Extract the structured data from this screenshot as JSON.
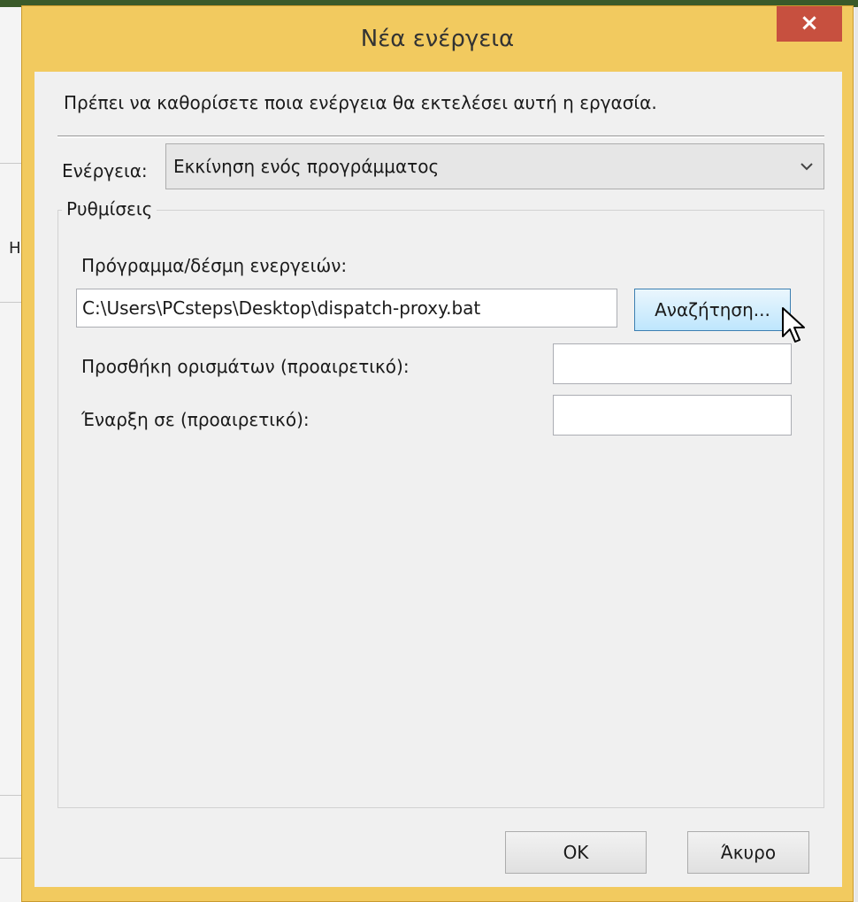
{
  "dialog": {
    "title": "Νέα ενέργεια",
    "close_label": "×",
    "instruction": "Πρέπει να καθορίσετε ποια ενέργεια θα εκτελέσει αυτή η εργασία."
  },
  "action": {
    "label": "Ενέργεια:",
    "selected": "Εκκίνηση ενός προγράμματος"
  },
  "settings": {
    "legend": "Ρυθμίσεις",
    "program_label": "Πρόγραμμα/δέσμη ενεργειών:",
    "program_value": "C:\\Users\\PCsteps\\Desktop\\dispatch-proxy.bat",
    "browse_label": "Αναζήτηση...",
    "args_label": "Προσθήκη ορισμάτων (προαιρετικό):",
    "args_value": "",
    "start_label": "Έναρξη σε (προαιρετικό):",
    "start_value": ""
  },
  "buttons": {
    "ok": "OK",
    "cancel": "Άκυρο"
  },
  "background_window": {
    "glyph": "Η"
  },
  "colors": {
    "title_bar": "#f2ca5f",
    "close_button": "#c7503f",
    "browse_highlight": "#bee6fd"
  },
  "icons": {
    "close": "close-icon",
    "dropdown": "chevron-down-icon",
    "cursor": "mouse-pointer-icon"
  }
}
